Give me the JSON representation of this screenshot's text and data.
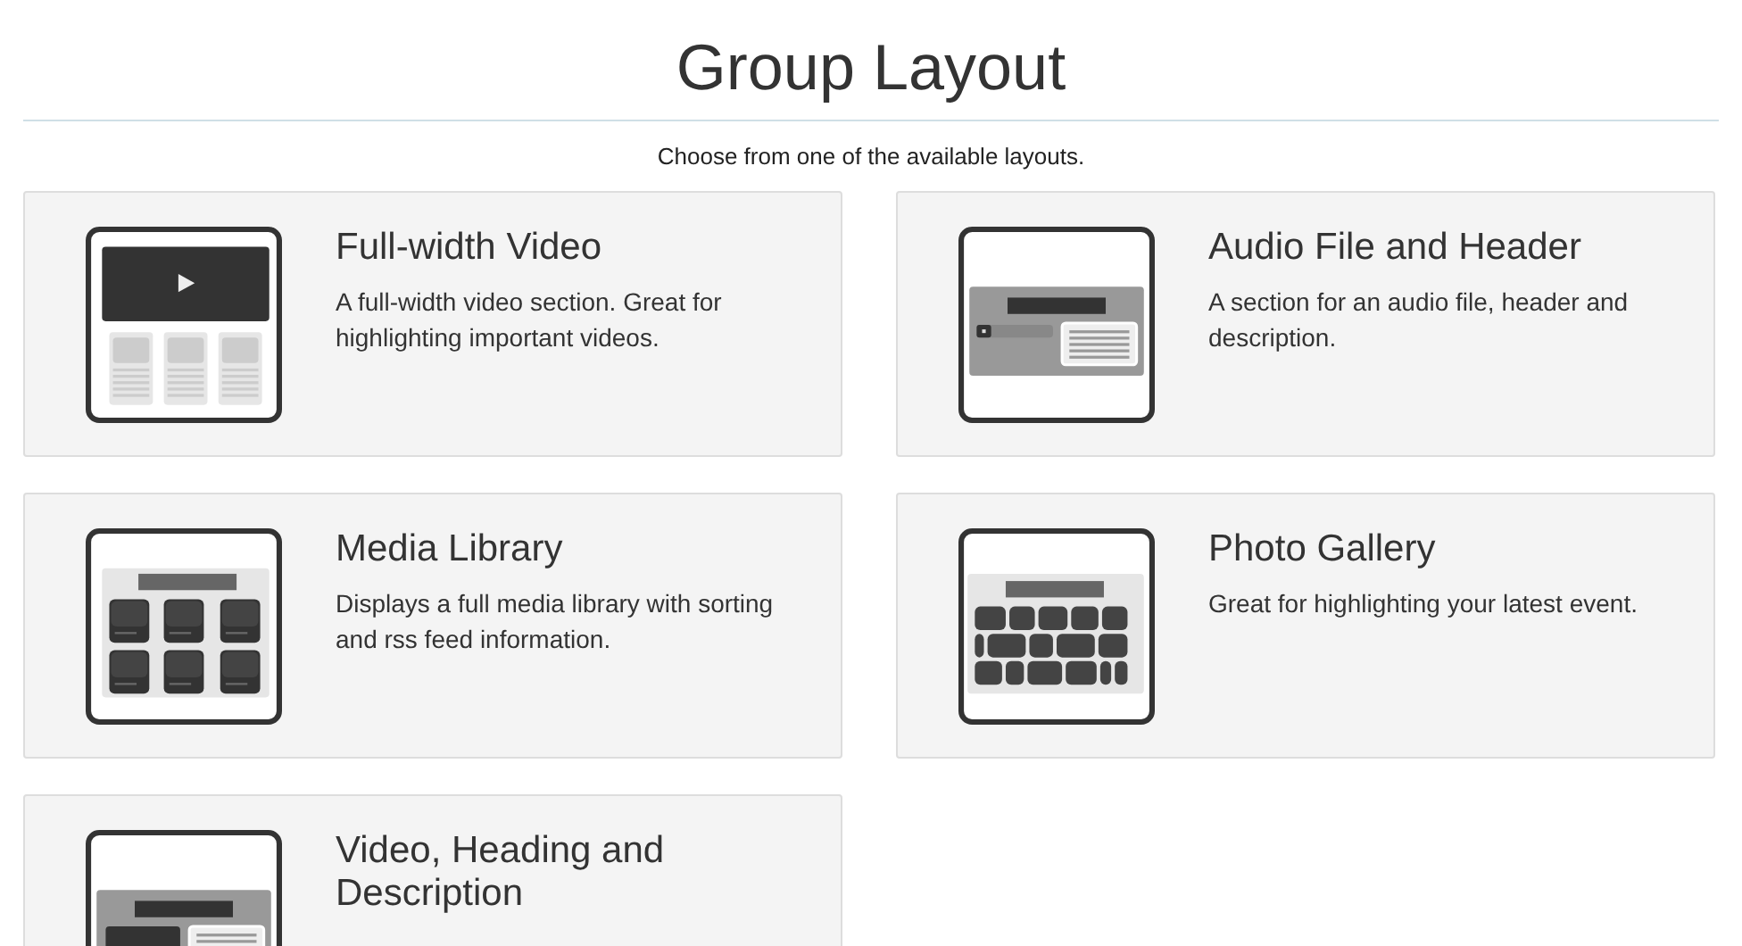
{
  "title": "Group Layout",
  "subtitle": "Choose from one of the available layouts.",
  "layouts": [
    {
      "kind": "video",
      "title": "Full-width Video",
      "description": "A full-width video section. Great for highlighting important videos."
    },
    {
      "kind": "audio",
      "title": "Audio File and Header",
      "description": "A section for an audio file, header and description."
    },
    {
      "kind": "library",
      "title": "Media Library",
      "description": "Displays a full media library with sorting and rss feed information."
    },
    {
      "kind": "gallery",
      "title": "Photo Gallery",
      "description": "Great for highlighting your latest event."
    },
    {
      "kind": "video-heading",
      "title": "Video, Heading and Description"
    }
  ]
}
